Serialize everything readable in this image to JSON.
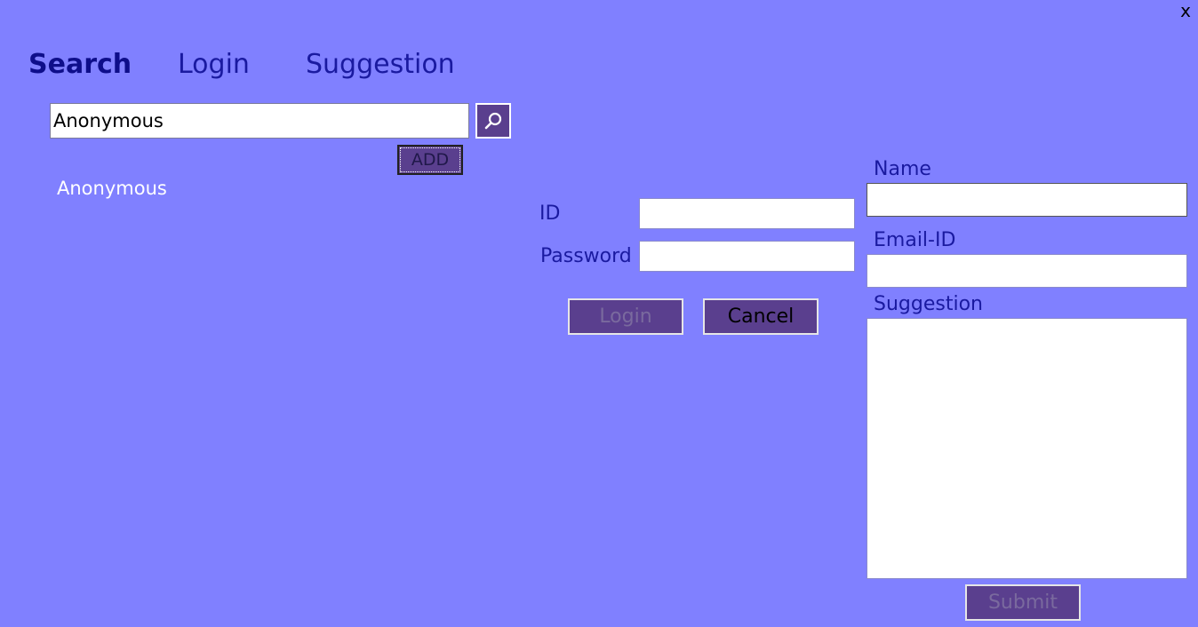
{
  "window": {
    "close_label": "x"
  },
  "tabs": [
    {
      "label": "Search",
      "active": true
    },
    {
      "label": "Login",
      "active": false
    },
    {
      "label": "Suggestion",
      "active": false
    }
  ],
  "search": {
    "input_value": "Anonymous",
    "button_icon": "search-icon",
    "add_label": "ADD",
    "results": [
      "Anonymous"
    ]
  },
  "login": {
    "id_label": "ID",
    "id_value": "",
    "password_label": "Password",
    "password_value": "",
    "login_label": "Login",
    "cancel_label": "Cancel"
  },
  "suggestion": {
    "name_label": "Name",
    "name_value": "",
    "email_label": "Email-ID",
    "email_value": "",
    "suggestion_label": "Suggestion",
    "suggestion_value": "",
    "submit_label": "Submit"
  },
  "colors": {
    "background": "#8080ff",
    "button": "#5a3f8e",
    "tab_text": "#1a1aa0"
  }
}
